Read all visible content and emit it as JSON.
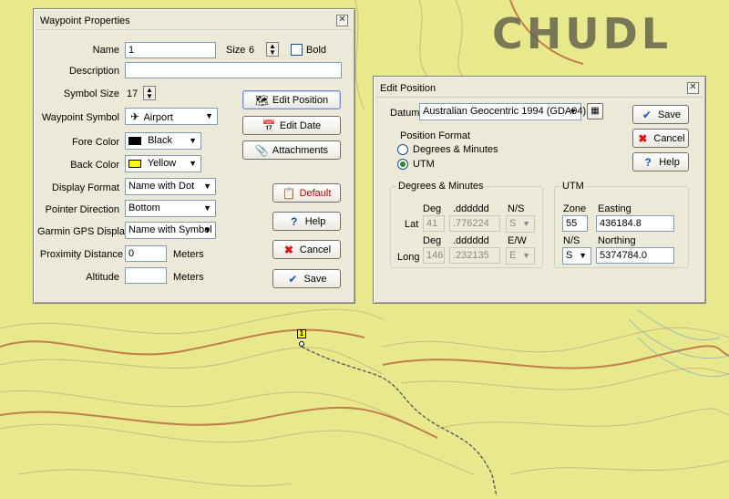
{
  "map": {
    "label": "CHUDL",
    "waypoint_marker": "1"
  },
  "waypoint_dialog": {
    "title": "Waypoint Properties",
    "name_label": "Name",
    "name_value": "1",
    "size_label": "Size",
    "size_value": "6",
    "bold_label": "Bold",
    "description_label": "Description",
    "description_value": "",
    "symbol_size_label": "Symbol Size",
    "symbol_size_value": "17",
    "waypoint_symbol_label": "Waypoint Symbol",
    "waypoint_symbol_value": "Airport",
    "fore_color_label": "Fore Color",
    "fore_color_value": "Black",
    "fore_color_hex": "#000000",
    "back_color_label": "Back Color",
    "back_color_value": "Yellow",
    "back_color_hex": "#ffff00",
    "display_format_label": "Display Format",
    "display_format_value": "Name with Dot",
    "pointer_direction_label": "Pointer Direction",
    "pointer_direction_value": "Bottom",
    "garmin_label": "Garmin GPS Display",
    "garmin_value": "Name with Symbol",
    "proximity_label": "Proximity Distance",
    "proximity_value": "0",
    "proximity_unit": "Meters",
    "altitude_label": "Altitude",
    "altitude_value": "",
    "altitude_unit": "Meters",
    "buttons": {
      "edit_position": "Edit Position",
      "edit_date": "Edit Date",
      "attachments": "Attachments",
      "default": "Default",
      "help": "Help",
      "cancel": "Cancel",
      "save": "Save"
    }
  },
  "edit_position_dialog": {
    "title": "Edit Position",
    "datum_label": "Datum",
    "datum_value": "Australian Geocentric 1994 (GDA94)",
    "position_format_label": "Position  Format",
    "format_dm": "Degrees & Minutes",
    "format_utm": "UTM",
    "dm_group_title": "Degrees & Minutes",
    "deg_header": "Deg",
    "dec_header": ".dddddd",
    "ns_header": "N/S",
    "ew_header": "E/W",
    "lat_label": "Lat",
    "lat_deg": "41",
    "lat_dec": ".776224",
    "lat_ns": "S",
    "long_label": "Long",
    "long_deg": "146",
    "long_dec": ".232135",
    "long_ew": "E",
    "utm_group_title": "UTM",
    "zone_label": "Zone",
    "zone_value": "55",
    "easting_label": "Easting",
    "easting_value": "436184.8",
    "utm_ns_label": "N/S",
    "utm_ns_value": "S",
    "northing_label": "Northing",
    "northing_value": "5374784.0",
    "buttons": {
      "save": "Save",
      "cancel": "Cancel",
      "help": "Help"
    }
  }
}
